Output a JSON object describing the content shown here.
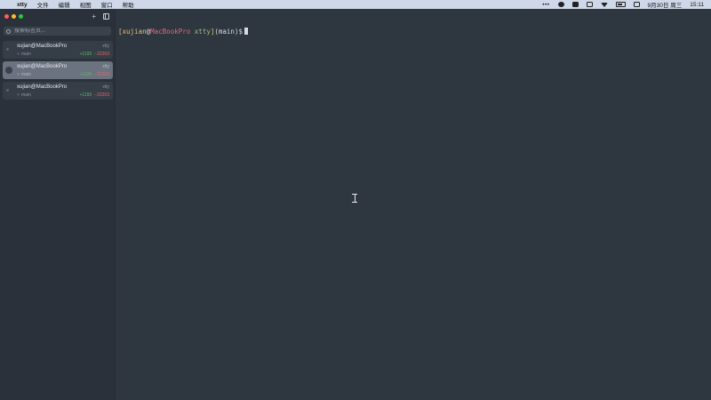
{
  "menubar": {
    "app_name": "xtty",
    "menus": [
      "文件",
      "编辑",
      "视图",
      "窗口",
      "帮助"
    ],
    "status_icons": [
      "more-icon",
      "wechat-icon",
      "screenshot-icon",
      "display-icon",
      "wifi-icon",
      "battery-icon",
      "control-center-icon"
    ],
    "date": "9月30日 周三",
    "time": "15:11"
  },
  "sidebar": {
    "add_label": "+",
    "search_placeholder": "搜索标签页...",
    "sessions": [
      {
        "title": "xujian@MacBookPro",
        "tag": "xtty",
        "branch_icon": "⑂",
        "branch": "main",
        "added": "+1193",
        "removed": "−22263"
      },
      {
        "title": "xujian@MacBookPro",
        "tag": "xtty",
        "branch_icon": "⑂",
        "branch": "main",
        "added": "+1193",
        "removed": "−22263"
      },
      {
        "title": "xujian@MacBookPro",
        "tag": "xtty",
        "branch_icon": "⑂",
        "branch": "main",
        "added": "+1193",
        "removed": "−22263"
      }
    ]
  },
  "terminal": {
    "open_bracket": "[",
    "user": "xujian",
    "at": "@",
    "host": "MacBookPro",
    "dir": "xtty",
    "close_bracket": "]",
    "branch": "(main)",
    "prompt_symbol": "$"
  },
  "colors": {
    "terminal_bg": "#2e3640",
    "sidebar_bg": "#2a313a",
    "active_session": "#6b7280",
    "added": "#5dbb63",
    "removed": "#e06c6c"
  }
}
